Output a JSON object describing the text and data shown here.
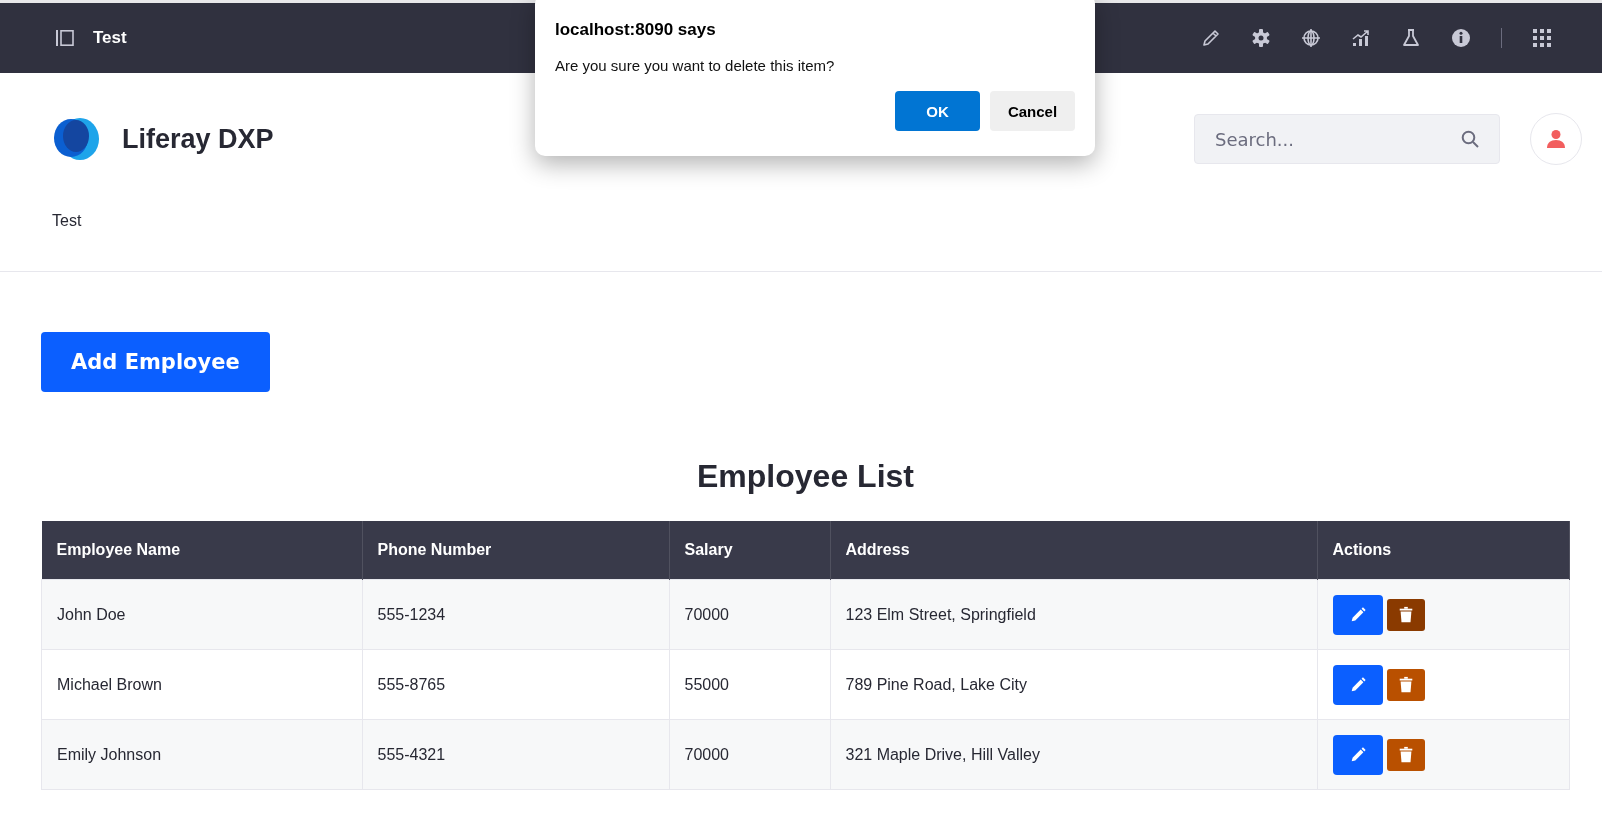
{
  "control_menu": {
    "title": "Test"
  },
  "header": {
    "site_name": "Liferay DXP",
    "search": {
      "placeholder": "Search..."
    }
  },
  "nav": {
    "items": [
      {
        "label": "Test"
      }
    ]
  },
  "add_button": {
    "label": "Add Employee"
  },
  "table": {
    "title": "Employee List",
    "columns": [
      "Employee Name",
      "Phone Number",
      "Salary",
      "Address",
      "Actions"
    ],
    "rows": [
      {
        "cells": [
          "John Doe",
          "555-1234",
          "70000",
          "123 Elm Street, Springfield"
        ],
        "delete_pressed": true
      },
      {
        "cells": [
          "Michael Brown",
          "555-8765",
          "55000",
          "789 Pine Road, Lake City"
        ],
        "delete_pressed": false
      },
      {
        "cells": [
          "Emily Johnson",
          "555-4321",
          "70000",
          "321 Maple Drive, Hill Valley"
        ],
        "delete_pressed": false
      }
    ]
  },
  "dialog": {
    "title": "localhost:8090 says",
    "message": "Are you sure you want to delete this item?",
    "buttons": [
      {
        "label": "OK",
        "kind": "primary"
      },
      {
        "label": "Cancel",
        "kind": "secondary"
      }
    ]
  }
}
